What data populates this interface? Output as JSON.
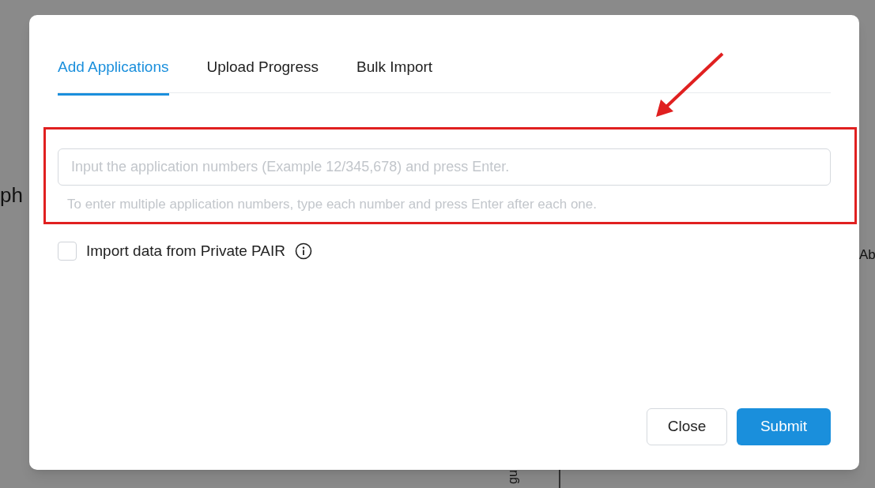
{
  "background": {
    "fragments": [
      "ph",
      "Ab",
      "gu"
    ]
  },
  "dialog": {
    "tabs": [
      {
        "label": "Add Applications",
        "selected": true
      },
      {
        "label": "Upload Progress",
        "selected": false
      },
      {
        "label": "Bulk Import",
        "selected": false
      }
    ],
    "input": {
      "placeholder": "Input the application numbers (Example 12/345,678) and press Enter."
    },
    "hint": "To enter multiple application numbers, type each number and press Enter after each one.",
    "checkbox": {
      "label": "Import data from Private PAIR",
      "checked": false
    },
    "buttons": [
      {
        "label": "Close",
        "kind": "secondary"
      },
      {
        "label": "Submit",
        "kind": "primary"
      }
    ]
  }
}
